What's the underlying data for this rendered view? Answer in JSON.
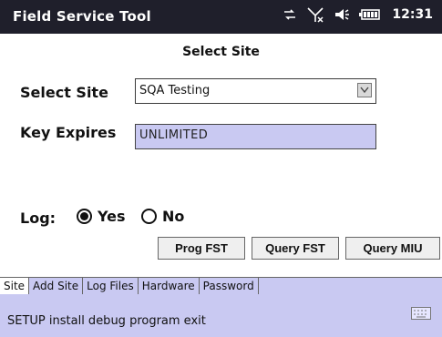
{
  "statusbar": {
    "app_title": "Field Service Tool",
    "time": "12:31"
  },
  "page": {
    "title": "Select Site"
  },
  "form": {
    "select_site_label": "Select Site",
    "select_site_value": "SQA Testing",
    "key_expires_label": "Key Expires",
    "key_expires_value": "UNLIMITED"
  },
  "log": {
    "label": "Log:",
    "yes_label": "Yes",
    "no_label": "No",
    "selected": "Yes"
  },
  "actions": {
    "prog_fst": "Prog FST",
    "query_fst": "Query FST",
    "query_miu": "Query MIU"
  },
  "tabs": [
    {
      "label": "Site",
      "active": true
    },
    {
      "label": "Add Site",
      "active": false
    },
    {
      "label": "Log Files",
      "active": false
    },
    {
      "label": "Hardware",
      "active": false
    },
    {
      "label": "Password",
      "active": false
    }
  ],
  "command_bar": {
    "text": "SETUP install debug program exit"
  },
  "icons": {
    "sync": "sync-icon",
    "signal": "signal-off-icon",
    "volume": "speaker-icon",
    "battery": "battery-icon",
    "keyboard": "keyboard-icon",
    "dropdown": "chevron-down-icon"
  },
  "colors": {
    "title_bar": "#1f1f2b",
    "accent": "#c9c9f2"
  }
}
